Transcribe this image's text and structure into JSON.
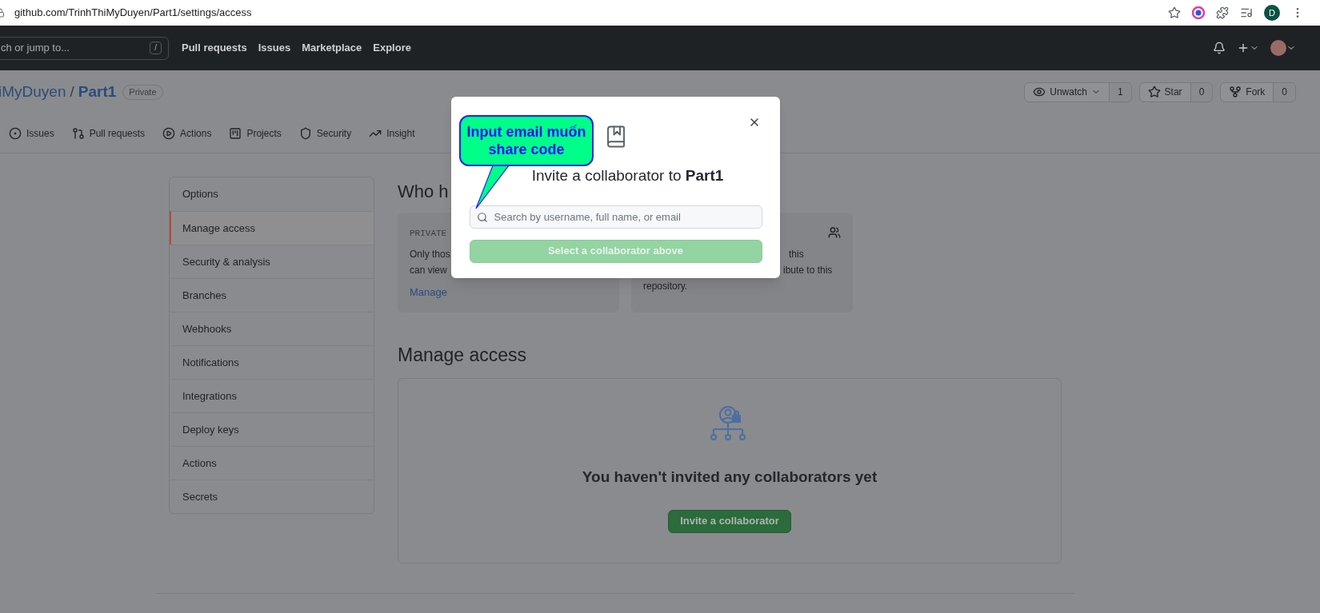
{
  "browser": {
    "url": "github.com/TrinhThiMyDuyen/Part1/settings/access",
    "profile_letter": "D"
  },
  "header": {
    "search_placeholder": "ch or jump to...",
    "search_key": "/",
    "nav": [
      "Pull requests",
      "Issues",
      "Marketplace",
      "Explore"
    ]
  },
  "repo": {
    "owner": "iMyDuyen",
    "separator": "/",
    "name": "Part1",
    "visibility": "Private",
    "actions": [
      {
        "kind": "watch",
        "label": "Unwatch",
        "count": "1"
      },
      {
        "kind": "star",
        "label": "Star",
        "count": "0"
      },
      {
        "kind": "fork",
        "label": "Fork",
        "count": "0"
      }
    ]
  },
  "tabs": [
    {
      "kind": "issues",
      "label": "Issues"
    },
    {
      "kind": "pulls",
      "label": "Pull requests"
    },
    {
      "kind": "actions",
      "label": "Actions"
    },
    {
      "kind": "projects",
      "label": "Projects"
    },
    {
      "kind": "security",
      "label": "Security"
    },
    {
      "kind": "insights",
      "label": "Insight"
    }
  ],
  "sidebar": {
    "items": [
      {
        "label": "Options",
        "selected": false
      },
      {
        "label": "Manage access",
        "selected": true
      },
      {
        "label": "Security & analysis",
        "selected": false
      },
      {
        "label": "Branches",
        "selected": false
      },
      {
        "label": "Webhooks",
        "selected": false
      },
      {
        "label": "Notifications",
        "selected": false
      },
      {
        "label": "Integrations",
        "selected": false
      },
      {
        "label": "Deploy keys",
        "selected": false
      },
      {
        "label": "Actions",
        "selected": false
      },
      {
        "label": "Secrets",
        "selected": false
      }
    ]
  },
  "who_has_access": {
    "title": "Who h",
    "cards": [
      {
        "kind": "visibility",
        "label": "PRIVATE",
        "lines": [
          "Only thos",
          "can view"
        ],
        "link": "Manage"
      },
      {
        "kind": "people",
        "lines": [
          "this",
          "ibute to this",
          "repository."
        ]
      }
    ]
  },
  "manage_access": {
    "title": "Manage access",
    "empty_text": "You haven't invited any collaborators yet",
    "button": "Invite a collaborator"
  },
  "dialog": {
    "title": "Invite a collaborator to **Part1**",
    "search_placeholder": "Search by username, full name, or email",
    "button": "Select a collaborator above",
    "button_disabled": true
  },
  "callout": {
    "text": "Input email muốn share code"
  }
}
